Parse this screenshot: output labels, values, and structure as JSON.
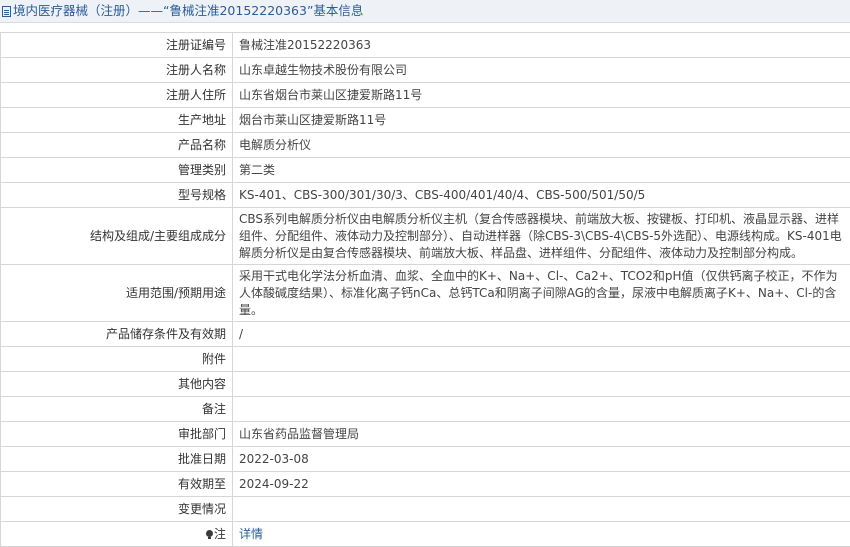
{
  "header": {
    "title": "境内医疗器械（注册）——“鲁械注准20152220363”基本信息"
  },
  "rows": [
    {
      "label": "注册证编号",
      "value": "鲁械注准20152220363"
    },
    {
      "label": "注册人名称",
      "value": "山东卓越生物技术股份有限公司"
    },
    {
      "label": "注册人住所",
      "value": "山东省烟台市莱山区捷爱斯路11号"
    },
    {
      "label": "生产地址",
      "value": "烟台市莱山区捷爱斯路11号"
    },
    {
      "label": "产品名称",
      "value": "电解质分析仪"
    },
    {
      "label": "管理类别",
      "value": "第二类"
    },
    {
      "label": "型号规格",
      "value": "KS-401、CBS-300/301/30/3、CBS-400/401/40/4、CBS-500/501/50/5"
    },
    {
      "label": "结构及组成/主要组成成分",
      "value": "CBS系列电解质分析仪由电解质分析仪主机（复合传感器模块、前端放大板、按键板、打印机、液晶显示器、进样组件、分配组件、液体动力及控制部分）、自动进样器（除CBS-3\\CBS-4\\CBS-5外选配）、电源线构成。KS-401电解质分析仪是由复合传感器模块、前端放大板、样品盘、进样组件、分配组件、液体动力及控制部分构成。"
    },
    {
      "label": "适用范围/预期用途",
      "value": "采用干式电化学法分析血清、血浆、全血中的K+、Na+、Cl-、Ca2+、TCO2和pH值（仅供钙离子校正，不作为人体酸碱度结果）、标准化离子钙nCa、总钙TCa和阴离子间隙AG的含量，尿液中电解质离子K+、Na+、Cl-的含量。"
    },
    {
      "label": "产品储存条件及有效期",
      "value": "/"
    },
    {
      "label": "附件",
      "value": ""
    },
    {
      "label": "其他内容",
      "value": ""
    },
    {
      "label": "备注",
      "value": ""
    },
    {
      "label": "审批部门",
      "value": "山东省药品监督管理局"
    },
    {
      "label": "批准日期",
      "value": "2022-03-08"
    },
    {
      "label": "有效期至",
      "value": "2024-09-22"
    },
    {
      "label": "变更情况",
      "value": ""
    }
  ],
  "note": {
    "label": "注",
    "link_text": "详情"
  }
}
